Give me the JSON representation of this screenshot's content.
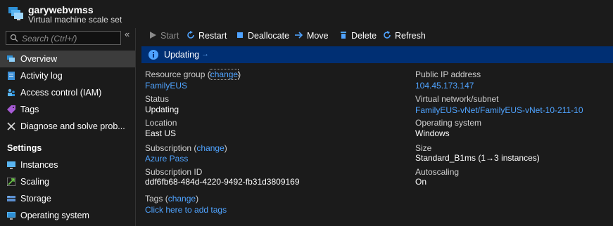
{
  "header": {
    "title": "garywebvmss",
    "subtitle": "Virtual machine scale set",
    "icon": "vmss-icon"
  },
  "sidebar": {
    "search_placeholder": "Search (Ctrl+/)",
    "collapse_glyph": "«",
    "items": [
      {
        "label": "Overview",
        "icon": "overview-icon",
        "selected": true
      },
      {
        "label": "Activity log",
        "icon": "activity-log-icon"
      },
      {
        "label": "Access control (IAM)",
        "icon": "access-control-icon"
      },
      {
        "label": "Tags",
        "icon": "tag-icon"
      },
      {
        "label": "Diagnose and solve prob...",
        "icon": "wrench-icon"
      }
    ],
    "section_settings": "Settings",
    "settings_items": [
      {
        "label": "Instances",
        "icon": "instances-icon"
      },
      {
        "label": "Scaling",
        "icon": "scaling-icon"
      },
      {
        "label": "Storage",
        "icon": "storage-icon"
      },
      {
        "label": "Operating system",
        "icon": "os-icon"
      }
    ]
  },
  "toolbar": {
    "start": "Start",
    "restart": "Restart",
    "deallocate": "Deallocate",
    "move": "Move",
    "delete": "Delete",
    "refresh": "Refresh"
  },
  "banner": {
    "text": "Updating",
    "arrow": "→"
  },
  "essentials": {
    "left": {
      "resource_group_label": "Resource group",
      "resource_group_change": "change",
      "resource_group_value": "FamilyEUS",
      "status_label": "Status",
      "status_value": "Updating",
      "location_label": "Location",
      "location_value": "East US",
      "subscription_label": "Subscription",
      "subscription_change": "change",
      "subscription_value": "Azure Pass",
      "subscription_id_label": "Subscription ID",
      "subscription_id_value": "ddf6fb68-484d-4220-9492-fb31d3809169",
      "tags_label": "Tags",
      "tags_change": "change",
      "tags_value": "Click here to add tags"
    },
    "right": {
      "public_ip_label": "Public IP address",
      "public_ip_value": "104.45.173.147",
      "vnet_label": "Virtual network/subnet",
      "vnet_value": "FamilyEUS-vNet/FamilyEUS-vNet-10-211-10",
      "os_label": "Operating system",
      "os_value": "Windows",
      "size_label": "Size",
      "size_value": "Standard_B1ms (1→3 instances)",
      "autoscaling_label": "Autoscaling",
      "autoscaling_value": "On"
    }
  },
  "colors": {
    "background": "#1b1b1b",
    "banner": "#002f73",
    "link": "#4fa3ff",
    "selected": "#3c3c3c"
  }
}
